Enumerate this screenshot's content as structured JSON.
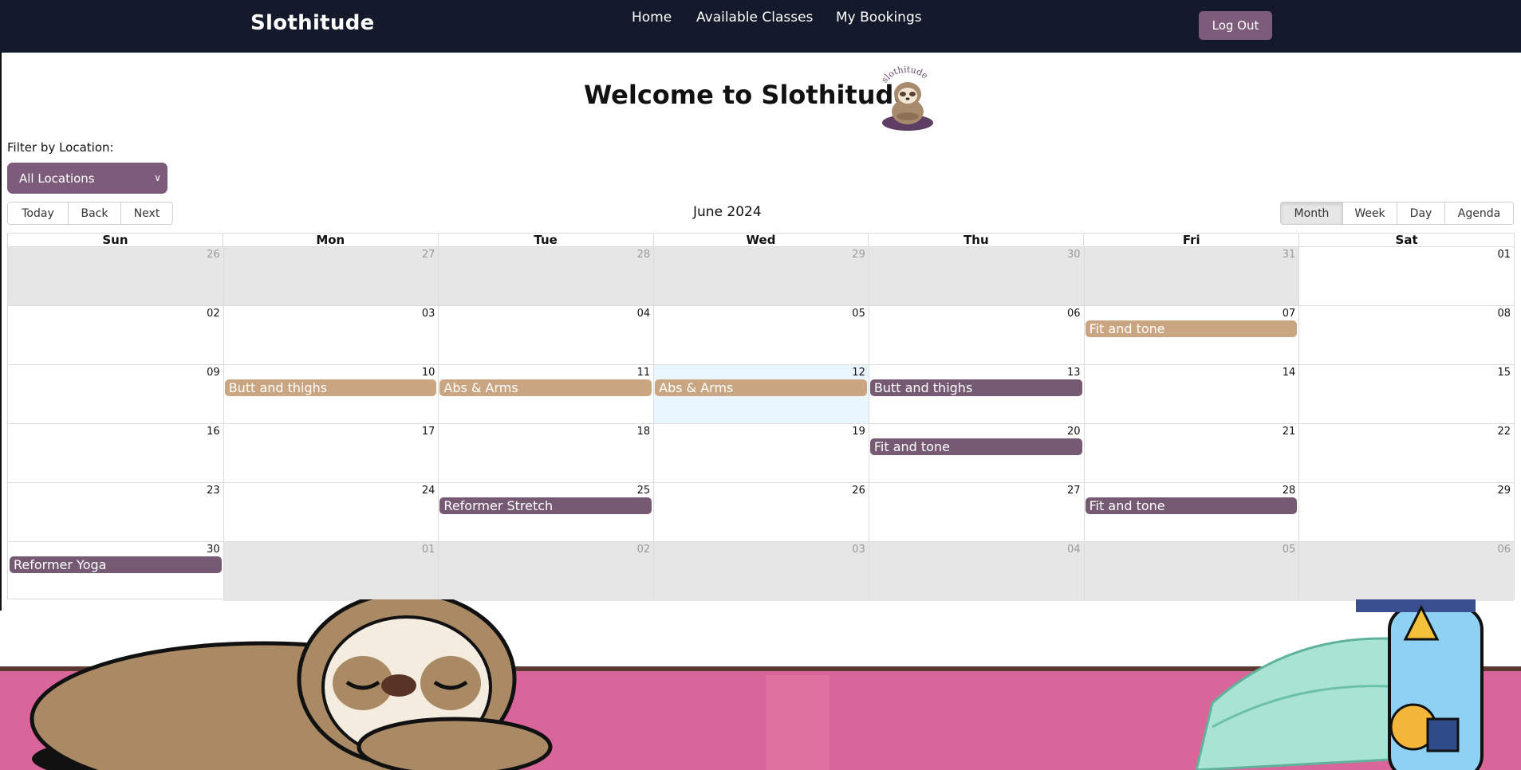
{
  "app": {
    "brand": "Slothitude"
  },
  "nav": {
    "home": "Home",
    "classes": "Available Classes",
    "bookings": "My Bookings",
    "logout": "Log Out"
  },
  "welcome": {
    "title": "Welcome to Slothitude",
    "logo_text": "slothitude"
  },
  "filter": {
    "label": "Filter by Location:",
    "selected": "All Locations"
  },
  "toolbar": {
    "today": "Today",
    "back": "Back",
    "next": "Next",
    "label": "June 2024",
    "views": [
      "Month",
      "Week",
      "Day",
      "Agenda"
    ],
    "active_view": "Month"
  },
  "calendar": {
    "days": [
      "Sun",
      "Mon",
      "Tue",
      "Wed",
      "Thu",
      "Fri",
      "Sat"
    ],
    "weeks": [
      [
        "26",
        "27",
        "28",
        "29",
        "30",
        "31",
        "01"
      ],
      [
        "02",
        "03",
        "04",
        "05",
        "06",
        "07",
        "08"
      ],
      [
        "09",
        "10",
        "11",
        "12",
        "13",
        "14",
        "15"
      ],
      [
        "16",
        "17",
        "18",
        "19",
        "20",
        "21",
        "22"
      ],
      [
        "23",
        "24",
        "25",
        "26",
        "27",
        "28",
        "29"
      ],
      [
        "30",
        "01",
        "02",
        "03",
        "04",
        "05",
        "06"
      ]
    ],
    "off_range": [
      [
        0,
        0
      ],
      [
        0,
        1
      ],
      [
        0,
        2
      ],
      [
        0,
        3
      ],
      [
        0,
        4
      ],
      [
        0,
        5
      ],
      [
        5,
        1
      ],
      [
        5,
        2
      ],
      [
        5,
        3
      ],
      [
        5,
        4
      ],
      [
        5,
        5
      ],
      [
        5,
        6
      ]
    ],
    "today": [
      2,
      3
    ],
    "events": [
      {
        "title": "Fit and tone",
        "week": 1,
        "day": 5,
        "color": "#c9a582"
      },
      {
        "title": "Butt and thighs",
        "week": 2,
        "day": 1,
        "color": "#c9a582"
      },
      {
        "title": "Abs & Arms",
        "week": 2,
        "day": 2,
        "color": "#c9a582"
      },
      {
        "title": "Abs & Arms",
        "week": 2,
        "day": 3,
        "color": "#c9a582"
      },
      {
        "title": "Butt and thighs",
        "week": 2,
        "day": 4,
        "color": "#765a74"
      },
      {
        "title": "Fit and tone",
        "week": 3,
        "day": 4,
        "color": "#765a74"
      },
      {
        "title": "Reformer Stretch",
        "week": 4,
        "day": 2,
        "color": "#765a74"
      },
      {
        "title": "Fit and tone",
        "week": 4,
        "day": 5,
        "color": "#765a74"
      },
      {
        "title": "Reformer Yoga",
        "week": 5,
        "day": 0,
        "color": "#765a74"
      }
    ]
  },
  "colors": {
    "nav_bg": "#141a2b",
    "accent": "#7c5c7a",
    "event_tan": "#c9a582",
    "event_purple": "#765a74"
  }
}
